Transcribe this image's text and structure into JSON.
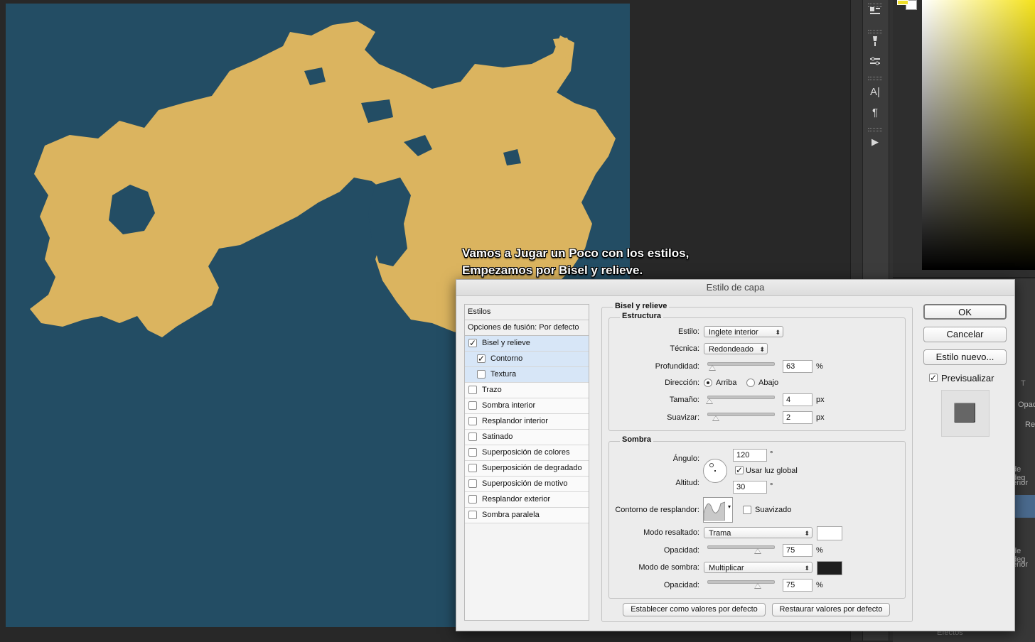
{
  "caption": {
    "line1": "Vamos a Jugar un Poco con los estilos,",
    "line2": "Empezamos por Bisel y relieve."
  },
  "canvas": {
    "ocean_color": "#234d64",
    "land_color": "#dbb45f"
  },
  "panel": {
    "fragments": [
      "T",
      "Opac",
      "Re",
      "de deg",
      "erior",
      "de deg",
      "erior",
      "Efectos"
    ]
  },
  "tools": [
    "settings-icon",
    "brush-icon",
    "adjust-icon",
    "character-icon",
    "paragraph-icon",
    "play-icon"
  ],
  "tool_glyphs": {
    "character": "A|",
    "paragraph": "¶",
    "play": "▶"
  },
  "dialog": {
    "title": "Estilo de capa",
    "styles_header": "Estilos",
    "blend_options": "Opciones de fusión: Por defecto",
    "styles": [
      {
        "label": "Bisel y relieve",
        "checked": true,
        "selected": true,
        "sub": false
      },
      {
        "label": "Contorno",
        "checked": true,
        "selected": true,
        "sub": true
      },
      {
        "label": "Textura",
        "checked": false,
        "selected": true,
        "sub": true
      },
      {
        "label": "Trazo",
        "checked": false,
        "selected": false,
        "sub": false
      },
      {
        "label": "Sombra interior",
        "checked": false,
        "selected": false,
        "sub": false
      },
      {
        "label": "Resplandor interior",
        "checked": false,
        "selected": false,
        "sub": false
      },
      {
        "label": "Satinado",
        "checked": false,
        "selected": false,
        "sub": false
      },
      {
        "label": "Superposición de colores",
        "checked": false,
        "selected": false,
        "sub": false
      },
      {
        "label": "Superposición de degradado",
        "checked": false,
        "selected": false,
        "sub": false
      },
      {
        "label": "Superposición de motivo",
        "checked": false,
        "selected": false,
        "sub": false
      },
      {
        "label": "Resplandor exterior",
        "checked": false,
        "selected": false,
        "sub": false
      },
      {
        "label": "Sombra paralela",
        "checked": false,
        "selected": false,
        "sub": false
      }
    ],
    "bevel": {
      "title": "Bisel y relieve",
      "structure_title": "Estructura",
      "style_label": "Estilo:",
      "style_value": "Inglete interior",
      "technique_label": "Técnica:",
      "technique_value": "Redondeado",
      "depth_label": "Profundidad:",
      "depth_value": "63",
      "depth_unit": "%",
      "depth_slider": 0.06,
      "direction_label": "Dirección:",
      "dir_up": "Arriba",
      "dir_down": "Abajo",
      "size_label": "Tamaño:",
      "size_value": "4",
      "size_unit": "px",
      "size_slider": 0.02,
      "soften_label": "Suavizar:",
      "soften_value": "2",
      "soften_unit": "px",
      "soften_slider": 0.12
    },
    "shading": {
      "title": "Sombra",
      "angle_label": "Ángulo:",
      "angle_value": "120",
      "angle_unit": "°",
      "global_light_label": "Usar luz global",
      "global_light": true,
      "altitude_label": "Altitud:",
      "altitude_value": "30",
      "altitude_unit": "°",
      "gloss_label": "Contorno de resplandor:",
      "antialias_label": "Suavizado",
      "antialias": false,
      "highlight_label": "Modo resaltado:",
      "highlight_value": "Trama",
      "highlight_color": "#ffffff",
      "highlight_opacity_label": "Opacidad:",
      "highlight_opacity": "75",
      "highlight_opacity_unit": "%",
      "highlight_slider": 0.75,
      "shadow_label": "Modo de sombra:",
      "shadow_value": "Multiplicar",
      "shadow_color": "#1e1e1e",
      "shadow_opacity_label": "Opacidad:",
      "shadow_opacity": "75",
      "shadow_opacity_unit": "%",
      "shadow_slider": 0.75
    },
    "make_default": "Establecer como valores por defecto",
    "reset_default": "Restaurar valores por defecto",
    "ok": "OK",
    "cancel": "Cancelar",
    "new_style": "Estilo nuevo...",
    "preview_label": "Previsualizar",
    "preview": true
  }
}
